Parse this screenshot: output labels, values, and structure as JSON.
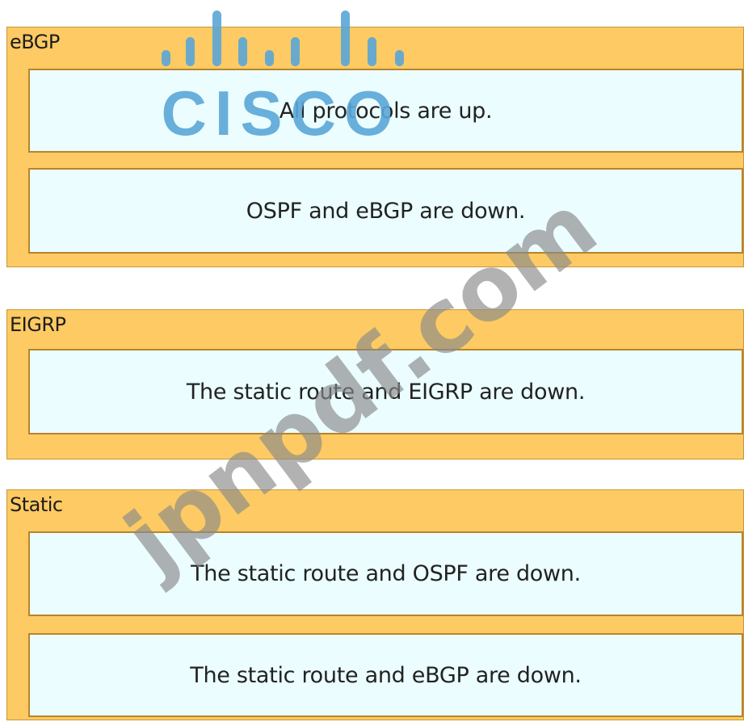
{
  "groups": [
    {
      "title": "eBGP",
      "answers": [
        "All protocols are up.",
        "OSPF and eBGP are down."
      ]
    },
    {
      "title": "EIGRP",
      "answers": [
        "The static route and EIGRP are down."
      ]
    },
    {
      "title": "Static",
      "answers": [
        "The static route and OSPF are down.",
        "The static route and eBGP are down."
      ]
    }
  ],
  "watermarks": {
    "logo_text": "CISCO",
    "site_text": "jpnpdf.com"
  },
  "colors": {
    "group_fill": "#fdca63",
    "answer_fill": "#ebfdfe",
    "answer_border": "#b7842b",
    "cisco_blue": "#5aa7d8",
    "watermark_grey": "#8a8a8a"
  }
}
